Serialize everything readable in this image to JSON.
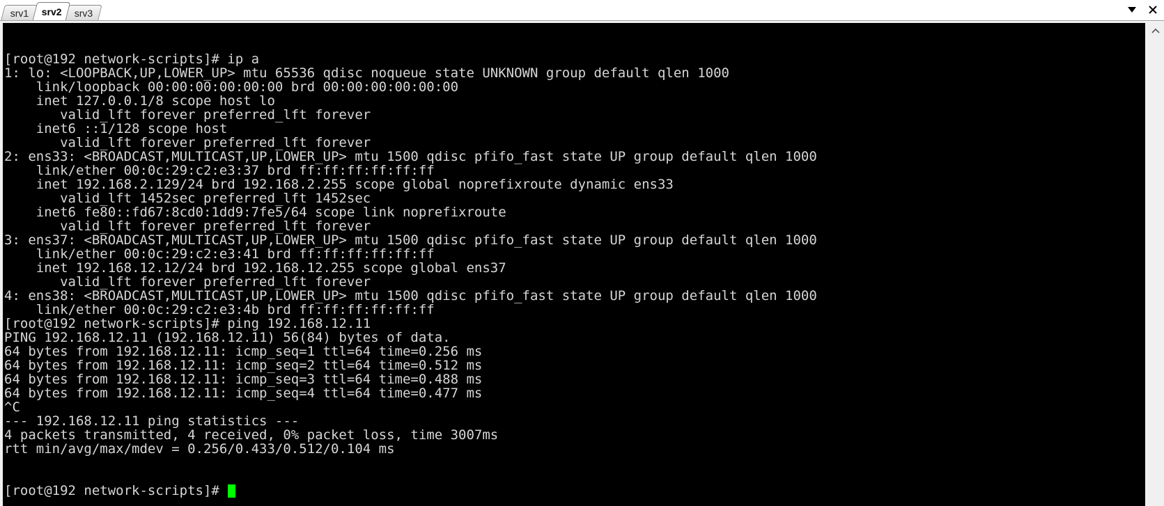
{
  "tabs": [
    {
      "label": "srv1",
      "active": false
    },
    {
      "label": "srv2",
      "active": true
    },
    {
      "label": "srv3",
      "active": false
    }
  ],
  "controls": {
    "menu_icon": "chevron-down-icon",
    "close_icon": "close-icon"
  },
  "terminal": {
    "lines": [
      "[root@192 network-scripts]# ip a",
      "1: lo: <LOOPBACK,UP,LOWER_UP> mtu 65536 qdisc noqueue state UNKNOWN group default qlen 1000",
      "    link/loopback 00:00:00:00:00:00 brd 00:00:00:00:00:00",
      "    inet 127.0.0.1/8 scope host lo",
      "       valid_lft forever preferred_lft forever",
      "    inet6 ::1/128 scope host",
      "       valid_lft forever preferred_lft forever",
      "2: ens33: <BROADCAST,MULTICAST,UP,LOWER_UP> mtu 1500 qdisc pfifo_fast state UP group default qlen 1000",
      "    link/ether 00:0c:29:c2:e3:37 brd ff:ff:ff:ff:ff:ff",
      "    inet 192.168.2.129/24 brd 192.168.2.255 scope global noprefixroute dynamic ens33",
      "       valid_lft 1452sec preferred_lft 1452sec",
      "    inet6 fe80::fd67:8cd0:1dd9:7fe5/64 scope link noprefixroute",
      "       valid_lft forever preferred_lft forever",
      "3: ens37: <BROADCAST,MULTICAST,UP,LOWER_UP> mtu 1500 qdisc pfifo_fast state UP group default qlen 1000",
      "    link/ether 00:0c:29:c2:e3:41 brd ff:ff:ff:ff:ff:ff",
      "    inet 192.168.12.12/24 brd 192.168.12.255 scope global ens37",
      "       valid_lft forever preferred_lft forever",
      "4: ens38: <BROADCAST,MULTICAST,UP,LOWER_UP> mtu 1500 qdisc pfifo_fast state UP group default qlen 1000",
      "    link/ether 00:0c:29:c2:e3:4b brd ff:ff:ff:ff:ff:ff",
      "[root@192 network-scripts]# ping 192.168.12.11",
      "PING 192.168.12.11 (192.168.12.11) 56(84) bytes of data.",
      "64 bytes from 192.168.12.11: icmp_seq=1 ttl=64 time=0.256 ms",
      "64 bytes from 192.168.12.11: icmp_seq=2 ttl=64 time=0.512 ms",
      "64 bytes from 192.168.12.11: icmp_seq=3 ttl=64 time=0.488 ms",
      "64 bytes from 192.168.12.11: icmp_seq=4 ttl=64 time=0.477 ms",
      "^C",
      "--- 192.168.12.11 ping statistics ---",
      "4 packets transmitted, 4 received, 0% packet loss, time 3007ms",
      "rtt min/avg/max/mdev = 0.256/0.433/0.512/0.104 ms"
    ],
    "prompt": "[root@192 network-scripts]# ",
    "colors": {
      "background": "#000000",
      "foreground": "#d6d6d6",
      "cursor": "#00ff00"
    }
  },
  "scrollbar": {
    "up_icon": "arrow-up-icon"
  }
}
